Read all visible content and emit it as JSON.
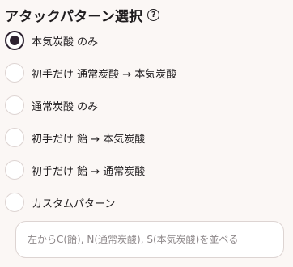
{
  "header": {
    "title": "アタックパターン選択",
    "help_glyph": "?"
  },
  "options": [
    {
      "label": "本気炭酸 のみ",
      "selected": true
    },
    {
      "label": "初手だけ 通常炭酸 → 本気炭酸",
      "selected": false
    },
    {
      "label": "通常炭酸 のみ",
      "selected": false
    },
    {
      "label": "初手だけ 飴 → 本気炭酸",
      "selected": false
    },
    {
      "label": "初手だけ 飴 → 通常炭酸",
      "selected": false
    },
    {
      "label": "カスタムパターン",
      "selected": false
    }
  ],
  "custom_pattern": {
    "value": "",
    "placeholder": "左からC(飴), N(通常炭酸), S(本気炭酸)を並べる"
  }
}
